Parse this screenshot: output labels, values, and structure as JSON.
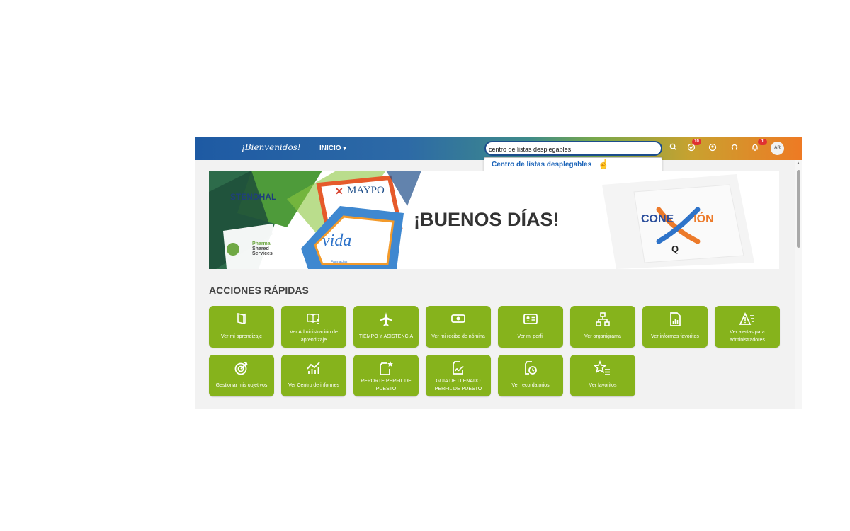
{
  "header": {
    "brand": "¡Bienvenidos!",
    "nav_label": "INICIO",
    "search_value": "centro de listas desplegables",
    "suggestion": "Centro de listas desplegables",
    "badges": {
      "tasks": "10",
      "notifications": "1"
    },
    "avatar_initials": "AR"
  },
  "banner": {
    "greeting": "¡BUENOS DÍAS!",
    "logos": {
      "stendhal": "STENDHAL",
      "maypo": "MAYPO",
      "vida": "vida",
      "vida_sub": "Farmacias",
      "pharma_1": "Pharma",
      "pharma_2": "Shared",
      "pharma_3": "Services"
    },
    "conexion_left": "CONE",
    "conexion_right": "IÓN",
    "conexion_sub": "Q"
  },
  "quick_actions": {
    "title": "ACCIONES RÁPIDAS",
    "tiles": [
      {
        "label": "Ver mi aprendizaje",
        "icon": "book-icon"
      },
      {
        "label": "Ver Administración de aprendizaje",
        "icon": "book-user-icon"
      },
      {
        "label": "TIEMPO Y ASISTENCIA",
        "icon": "airplane-icon"
      },
      {
        "label": "Ver mi recibo de nómina",
        "icon": "money-icon"
      },
      {
        "label": "Ver mi perfil",
        "icon": "id-card-icon"
      },
      {
        "label": "Ver organigrama",
        "icon": "org-chart-icon"
      },
      {
        "label": "Ver informes favoritos",
        "icon": "report-chart-icon"
      },
      {
        "label": "Ver alertas para administradores",
        "icon": "alert-list-icon"
      },
      {
        "label": "Gestionar mis objetivos",
        "icon": "target-icon"
      },
      {
        "label": "Ver Centro de informes",
        "icon": "trend-chart-icon"
      },
      {
        "label": "REPORTE PERFIL DE PUESTO",
        "icon": "document-star-icon"
      },
      {
        "label": "GUIA DE LLENADO PERFIL DE PUESTO",
        "icon": "document-sign-icon"
      },
      {
        "label": "Ver recordatorios",
        "icon": "document-clock-icon"
      },
      {
        "label": "Ver favoritos",
        "icon": "star-list-icon"
      }
    ]
  },
  "colors": {
    "tile_green": "#86b31c",
    "header_blue": "#1e5aa3",
    "header_orange": "#ee7a24",
    "link_blue": "#1a63b8",
    "badge_red": "#e03131"
  }
}
